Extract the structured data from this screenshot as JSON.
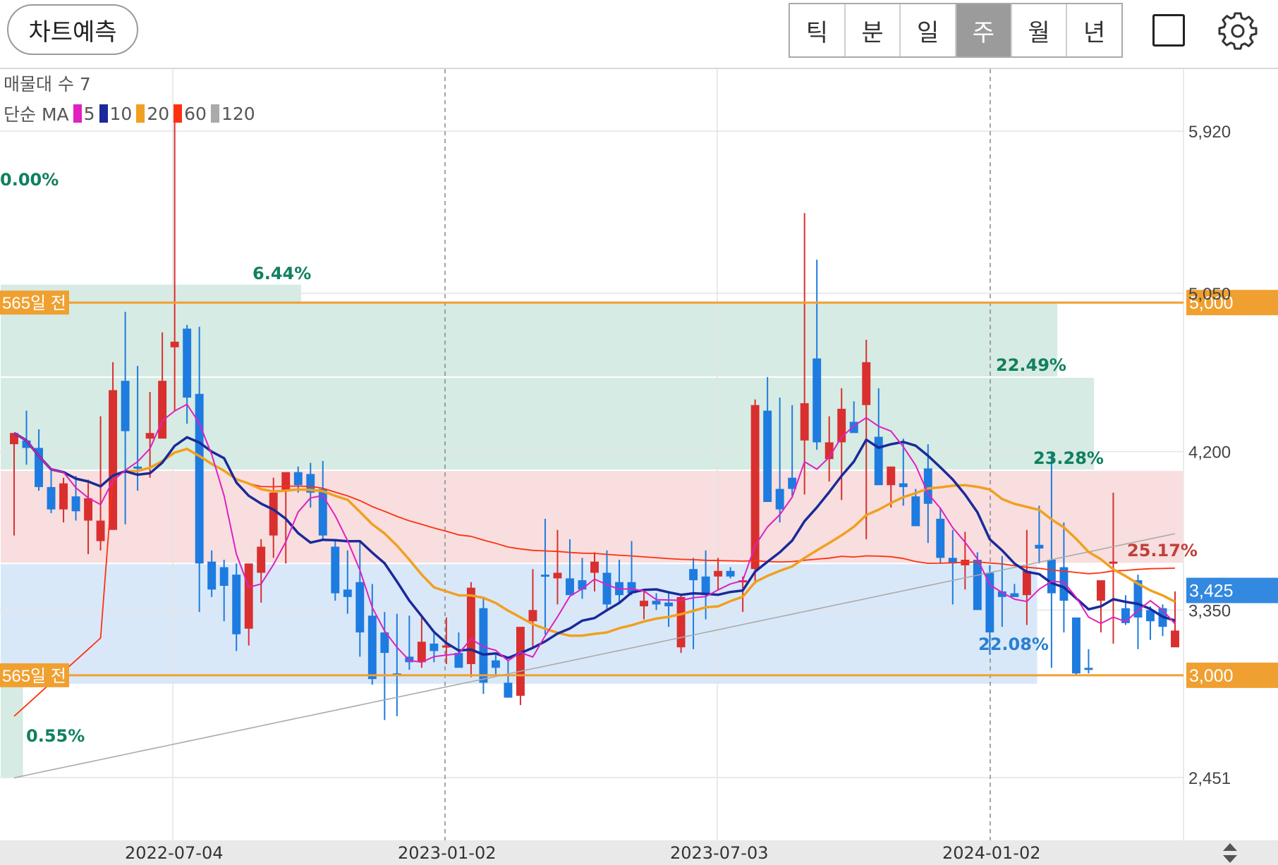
{
  "header": {
    "predict_button": "차트예측",
    "tabs": [
      "틱",
      "분",
      "일",
      "주",
      "월",
      "년"
    ],
    "active_tab": "주",
    "icons": [
      "square-icon",
      "gear-icon"
    ]
  },
  "legend": {
    "volume_profile": "매물대 수 7",
    "ma_label": "단순 MA",
    "ma_periods": [
      {
        "period": "5",
        "color": "#e020c0"
      },
      {
        "period": "10",
        "color": "#1a2a9a"
      },
      {
        "period": "20",
        "color": "#f0a020"
      },
      {
        "period": "60",
        "color": "#ff3010"
      },
      {
        "period": "120",
        "color": "#aaaaaa"
      }
    ]
  },
  "colors": {
    "up": "#d92f2f",
    "down": "#1e7be0",
    "accent_orange": "#f0a030",
    "current_price_box": "#3388e0"
  },
  "chart_data": {
    "type": "candlestick",
    "y_ticks": [
      "5,920",
      "5,050",
      "4,200",
      "3,350",
      "2,451"
    ],
    "x_ticks": [
      "2022-07-04",
      "2023-01-02",
      "2023-07-03",
      "2024-01-02"
    ],
    "ylim": [
      2200,
      6300
    ],
    "horizontal_lines": [
      {
        "label": "565일 전",
        "value": 5000,
        "value_label": "5,000"
      },
      {
        "label": "565일 전",
        "value": 3000,
        "value_label": "3,000"
      }
    ],
    "current_price": {
      "value": 3425,
      "label": "3,425"
    },
    "volume_profile_bands": [
      {
        "low": 4600,
        "high": 5100,
        "width": 0.255,
        "color": "green",
        "label": "6.44%"
      },
      {
        "low": 4600,
        "high": 5000,
        "width": 0.894,
        "color": "green",
        "label": "22.49%"
      },
      {
        "low": 4100,
        "high": 4600,
        "width": 0.925,
        "color": "green",
        "label": "23.28%"
      },
      {
        "low": 3600,
        "high": 4100,
        "width": 1.0,
        "color": "red",
        "label": "25.17%"
      },
      {
        "low": 2950,
        "high": 3600,
        "width": 0.877,
        "color": "blue",
        "label": "22.08%"
      },
      {
        "low": 2450,
        "high": 2950,
        "width": 0.02,
        "color": "green",
        "label": "0.55%"
      },
      {
        "low": 5500,
        "high": 6300,
        "width": 0.0,
        "color": "green",
        "label": "0.00%"
      }
    ],
    "candles_ohlc": [
      [
        4240,
        4300,
        3750,
        4300
      ],
      [
        4260,
        4420,
        4130,
        4220
      ],
      [
        4220,
        4320,
        3990,
        4010
      ],
      [
        4010,
        4110,
        3870,
        3890
      ],
      [
        3890,
        4060,
        3820,
        4030
      ],
      [
        3960,
        4070,
        3830,
        3880
      ],
      [
        3830,
        4050,
        3650,
        3950
      ],
      [
        3720,
        4390,
        3670,
        3830
      ],
      [
        3780,
        4680,
        3800,
        4530
      ],
      [
        4580,
        4950,
        3810,
        4310
      ],
      [
        4120,
        4660,
        3990,
        4110
      ],
      [
        4270,
        4520,
        4060,
        4300
      ],
      [
        4270,
        4840,
        4290,
        4580
      ],
      [
        4760,
        6000,
        4420,
        4790
      ],
      [
        4860,
        4880,
        4350,
        4490
      ],
      [
        4510,
        4870,
        3340,
        3600
      ],
      [
        3610,
        3670,
        3420,
        3460
      ],
      [
        3580,
        3620,
        3290,
        3480
      ],
      [
        3540,
        3600,
        3130,
        3220
      ],
      [
        3250,
        3570,
        3160,
        3600
      ],
      [
        3550,
        3730,
        3390,
        3690
      ],
      [
        3750,
        4060,
        3630,
        3980
      ],
      [
        3990,
        4070,
        3600,
        4090
      ],
      [
        4090,
        4120,
        3980,
        4020
      ],
      [
        4080,
        4140,
        3900,
        3980
      ],
      [
        4000,
        4150,
        3730,
        3750
      ],
      [
        3690,
        3730,
        3400,
        3440
      ],
      [
        3460,
        3670,
        3330,
        3420
      ],
      [
        3500,
        3720,
        3100,
        3230
      ],
      [
        3320,
        3490,
        2950,
        2980
      ],
      [
        3230,
        3340,
        2760,
        3120
      ],
      [
        3010,
        3330,
        2780,
        3000
      ],
      [
        3100,
        3320,
        3030,
        3070
      ],
      [
        3070,
        3320,
        3040,
        3180
      ],
      [
        3170,
        3240,
        3070,
        3130
      ],
      [
        3160,
        3310,
        3060,
        3160
      ],
      [
        3120,
        3230,
        3080,
        3040
      ],
      [
        3060,
        3500,
        2990,
        3470
      ],
      [
        3360,
        3410,
        2900,
        2960
      ],
      [
        3080,
        3110,
        3000,
        3040
      ],
      [
        2960,
        3080,
        2940,
        2880
      ],
      [
        2890,
        3160,
        2840,
        3260
      ],
      [
        3290,
        3570,
        3150,
        3350
      ],
      [
        3540,
        3840,
        3220,
        3530
      ],
      [
        3520,
        3780,
        3380,
        3550
      ],
      [
        3520,
        3730,
        3450,
        3430
      ],
      [
        3510,
        3630,
        3410,
        3460
      ],
      [
        3550,
        3660,
        3450,
        3610
      ],
      [
        3550,
        3670,
        3350,
        3380
      ],
      [
        3500,
        3620,
        3390,
        3430
      ],
      [
        3500,
        3720,
        3430,
        3440
      ],
      [
        3370,
        3460,
        3300,
        3400
      ],
      [
        3400,
        3440,
        3350,
        3380
      ],
      [
        3390,
        3450,
        3260,
        3370
      ],
      [
        3150,
        3430,
        3120,
        3420
      ],
      [
        3570,
        3630,
        3140,
        3510
      ],
      [
        3530,
        3670,
        3300,
        3430
      ],
      [
        3530,
        3630,
        3460,
        3560
      ],
      [
        3560,
        3580,
        3520,
        3530
      ],
      [
        3500,
        3530,
        3340,
        3510
      ],
      [
        3570,
        4480,
        3490,
        4450
      ],
      [
        4420,
        4600,
        3950,
        3930
      ],
      [
        4000,
        4490,
        3820,
        3890
      ],
      [
        4060,
        4450,
        3960,
        4000
      ],
      [
        4260,
        5480,
        3970,
        4460
      ],
      [
        4700,
        5230,
        4210,
        4250
      ],
      [
        4160,
        4390,
        4040,
        4250
      ],
      [
        4250,
        4540,
        3940,
        4430
      ],
      [
        4360,
        4470,
        4310,
        4300
      ],
      [
        4450,
        4800,
        3730,
        4680
      ],
      [
        4280,
        4540,
        4090,
        4020
      ],
      [
        4020,
        4120,
        3900,
        4120
      ],
      [
        4030,
        4270,
        3910,
        4010
      ],
      [
        3960,
        4000,
        3930,
        3800
      ],
      [
        4110,
        4240,
        3710,
        3920
      ],
      [
        3840,
        3900,
        3600,
        3630
      ],
      [
        3630,
        3780,
        3380,
        3600
      ],
      [
        3590,
        3770,
        3460,
        3620
      ],
      [
        3620,
        3660,
        3400,
        3350
      ],
      [
        3550,
        3590,
        3110,
        3230
      ],
      [
        3450,
        3640,
        3260,
        3420
      ],
      [
        3440,
        3490,
        3440,
        3420
      ],
      [
        3430,
        3780,
        3270,
        3560
      ],
      [
        3700,
        3910,
        3600,
        3680
      ],
      [
        3620,
        4200,
        3040,
        3440
      ],
      [
        3580,
        3820,
        3230,
        3400
      ],
      [
        3310,
        3300,
        3000,
        3010
      ],
      [
        3040,
        3140,
        3010,
        3030
      ],
      [
        3400,
        3500,
        3230,
        3510
      ],
      [
        3600,
        3980,
        3170,
        3610
      ],
      [
        3360,
        3430,
        3270,
        3280
      ],
      [
        3510,
        3540,
        3140,
        3310
      ],
      [
        3350,
        3370,
        3190,
        3290
      ],
      [
        3360,
        3380,
        3210,
        3260
      ],
      [
        3150,
        3450,
        3190,
        3240
      ]
    ]
  },
  "x_ticks_display": {
    "a": "2022-07-04",
    "b": "2023-01-02",
    "c": "2023-07-03",
    "d": "2024-01-02"
  }
}
